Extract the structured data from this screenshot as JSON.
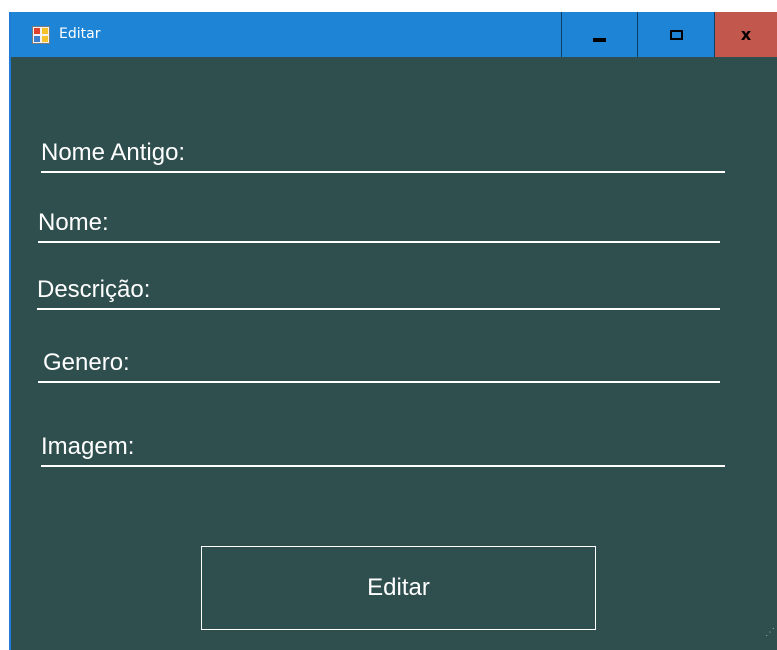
{
  "window": {
    "title": "Editar",
    "controls": {
      "minimize": "minimize-icon",
      "maximize": "maximize-icon",
      "close": "close-icon",
      "close_glyph": "x"
    }
  },
  "form": {
    "fields": [
      {
        "label": "Nome Antigo:"
      },
      {
        "label": "Nome:"
      },
      {
        "label": "Descrição:"
      },
      {
        "label": "Genero:"
      },
      {
        "label": "Imagem:"
      }
    ],
    "submit_label": "Editar"
  },
  "colors": {
    "background": "#2f4f4f",
    "titlebar": "#1e84d6",
    "close_button": "#c1574d",
    "text": "#ffffff"
  }
}
